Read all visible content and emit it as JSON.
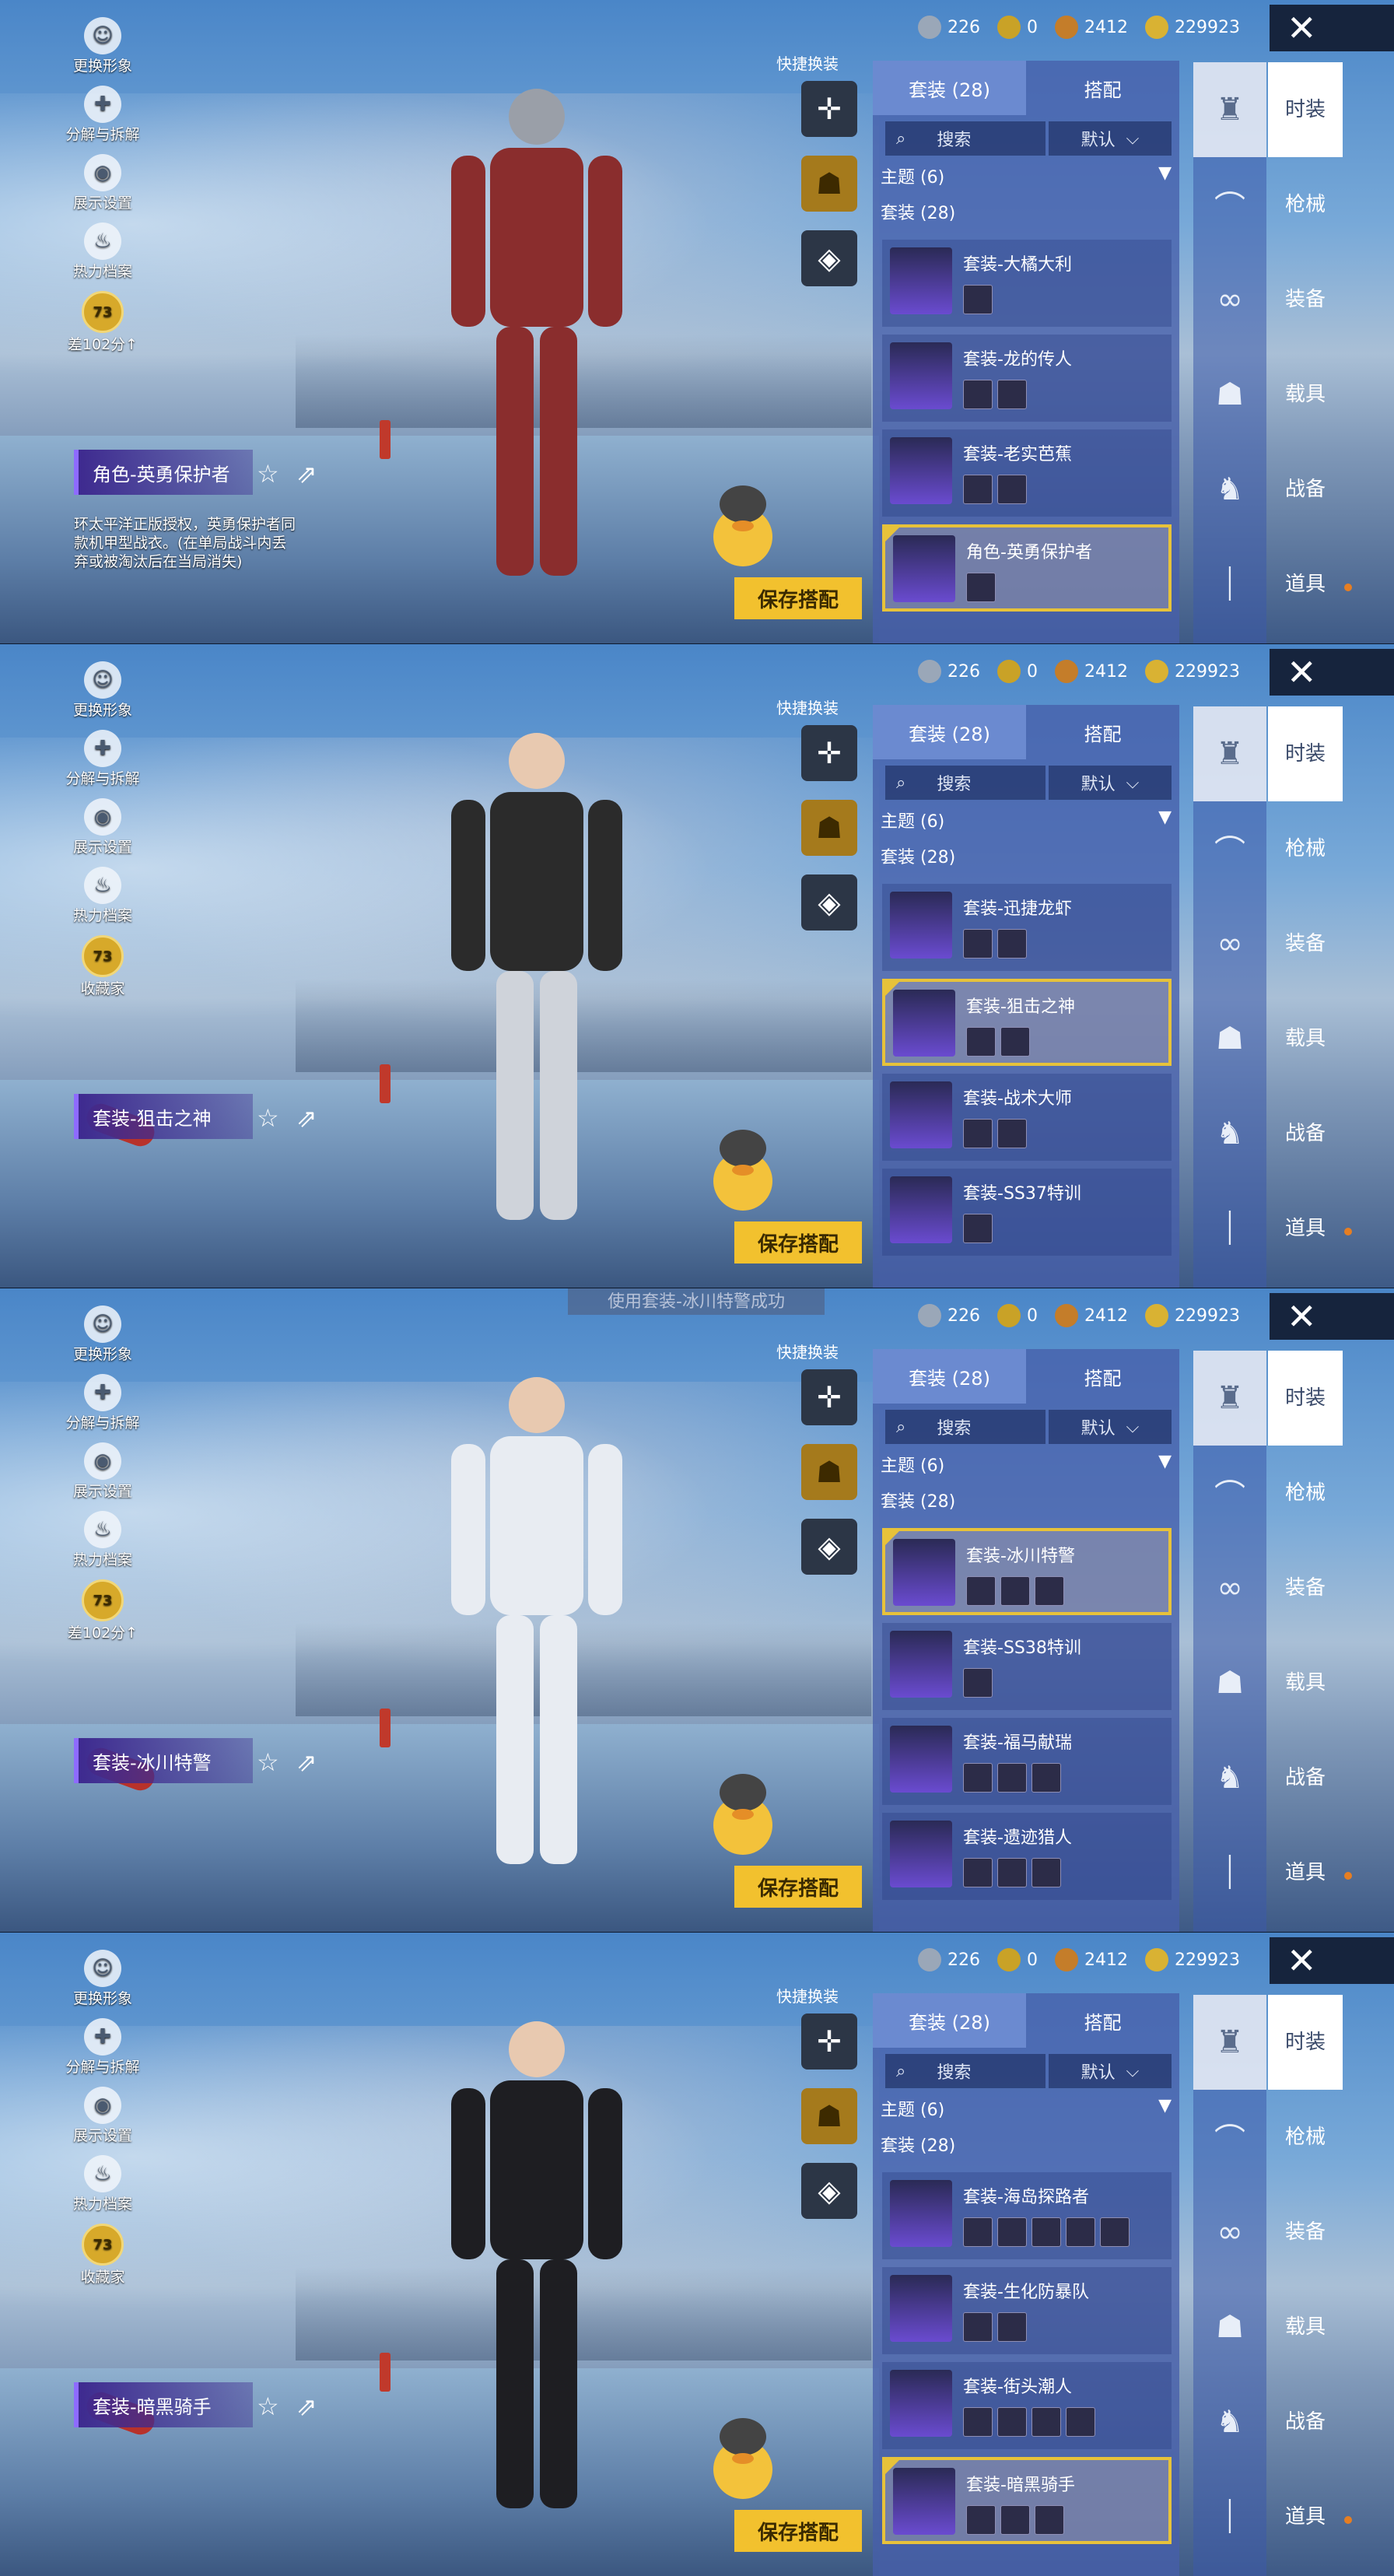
{
  "currency": [
    {
      "value": "226",
      "color": "#9aa7b8",
      "icon": "diamond-coin-icon"
    },
    {
      "value": "0",
      "color": "#c9a227",
      "icon": "a-coin-icon"
    },
    {
      "value": "2412",
      "color": "#c47d2a",
      "icon": "b-coin-icon"
    },
    {
      "value": "229923",
      "color": "#d9b233",
      "icon": "lightning-coin-icon"
    }
  ],
  "common": {
    "quick_switch": "快捷换装",
    "tab_suit": "套装 (28)",
    "tab_match": "搭配",
    "search_placeholder": "搜索",
    "sort": "默认",
    "theme": "主题 (6)",
    "suit_count": "套装 (28)",
    "save_button": "保存搭配",
    "categories": [
      "时装",
      "枪械",
      "装备",
      "载具",
      "战备",
      "道具"
    ]
  },
  "panels": [
    {
      "menu": [
        "更换形象",
        "分解与拆解",
        "展示设置",
        "热力档案",
        "差102分↑"
      ],
      "badge": "73",
      "character_title": "角色-英勇保护者",
      "description": "环太平洋正版授权，英勇保护者同款机甲型战衣。(在单局战斗内丢弃或被淘汰后在当局消失)",
      "toast": "",
      "items": [
        {
          "name": "套装-大橘大利",
          "parts": 1,
          "selected": false
        },
        {
          "name": "套装-龙的传人",
          "parts": 2,
          "selected": false
        },
        {
          "name": "套装-老实芭蕉",
          "parts": 2,
          "selected": false
        },
        {
          "name": "角色-英勇保护者",
          "parts": 1,
          "selected": true
        }
      ]
    },
    {
      "menu": [
        "更换形象",
        "分解与拆解",
        "展示设置",
        "热力档案",
        "收藏家"
      ],
      "badge": "73",
      "character_title": "套装-狙击之神",
      "description": "",
      "toast": "",
      "items": [
        {
          "name": "套装-迅捷龙虾",
          "parts": 2,
          "selected": false
        },
        {
          "name": "套装-狙击之神",
          "parts": 2,
          "selected": true
        },
        {
          "name": "套装-战术大师",
          "parts": 2,
          "selected": false
        },
        {
          "name": "套装-SS37特训",
          "parts": 1,
          "selected": false
        }
      ]
    },
    {
      "menu": [
        "更换形象",
        "分解与拆解",
        "展示设置",
        "热力档案",
        "差102分↑"
      ],
      "badge": "73",
      "character_title": "套装-冰川特警",
      "description": "",
      "toast": "使用套装-冰川特警成功",
      "items": [
        {
          "name": "套装-冰川特警",
          "parts": 3,
          "selected": true
        },
        {
          "name": "套装-SS38特训",
          "parts": 1,
          "selected": false
        },
        {
          "name": "套装-福马献瑞",
          "parts": 3,
          "selected": false
        },
        {
          "name": "套装-遗迹猎人",
          "parts": 3,
          "selected": false
        }
      ]
    },
    {
      "menu": [
        "更换形象",
        "分解与拆解",
        "展示设置",
        "热力档案",
        "收藏家"
      ],
      "badge": "73",
      "character_title": "套装-暗黑骑手",
      "description": "",
      "toast": "",
      "items": [
        {
          "name": "套装-海岛探路者",
          "parts": 5,
          "selected": false
        },
        {
          "name": "套装-生化防暴队",
          "parts": 2,
          "selected": false
        },
        {
          "name": "套装-街头潮人",
          "parts": 4,
          "selected": false
        },
        {
          "name": "套装-暗黑骑手",
          "parts": 3,
          "selected": true
        }
      ]
    }
  ],
  "colors": {
    "accent": "#f2c12e",
    "selected_border": "#e7c23a",
    "title_bar": "#3e2a8f"
  }
}
